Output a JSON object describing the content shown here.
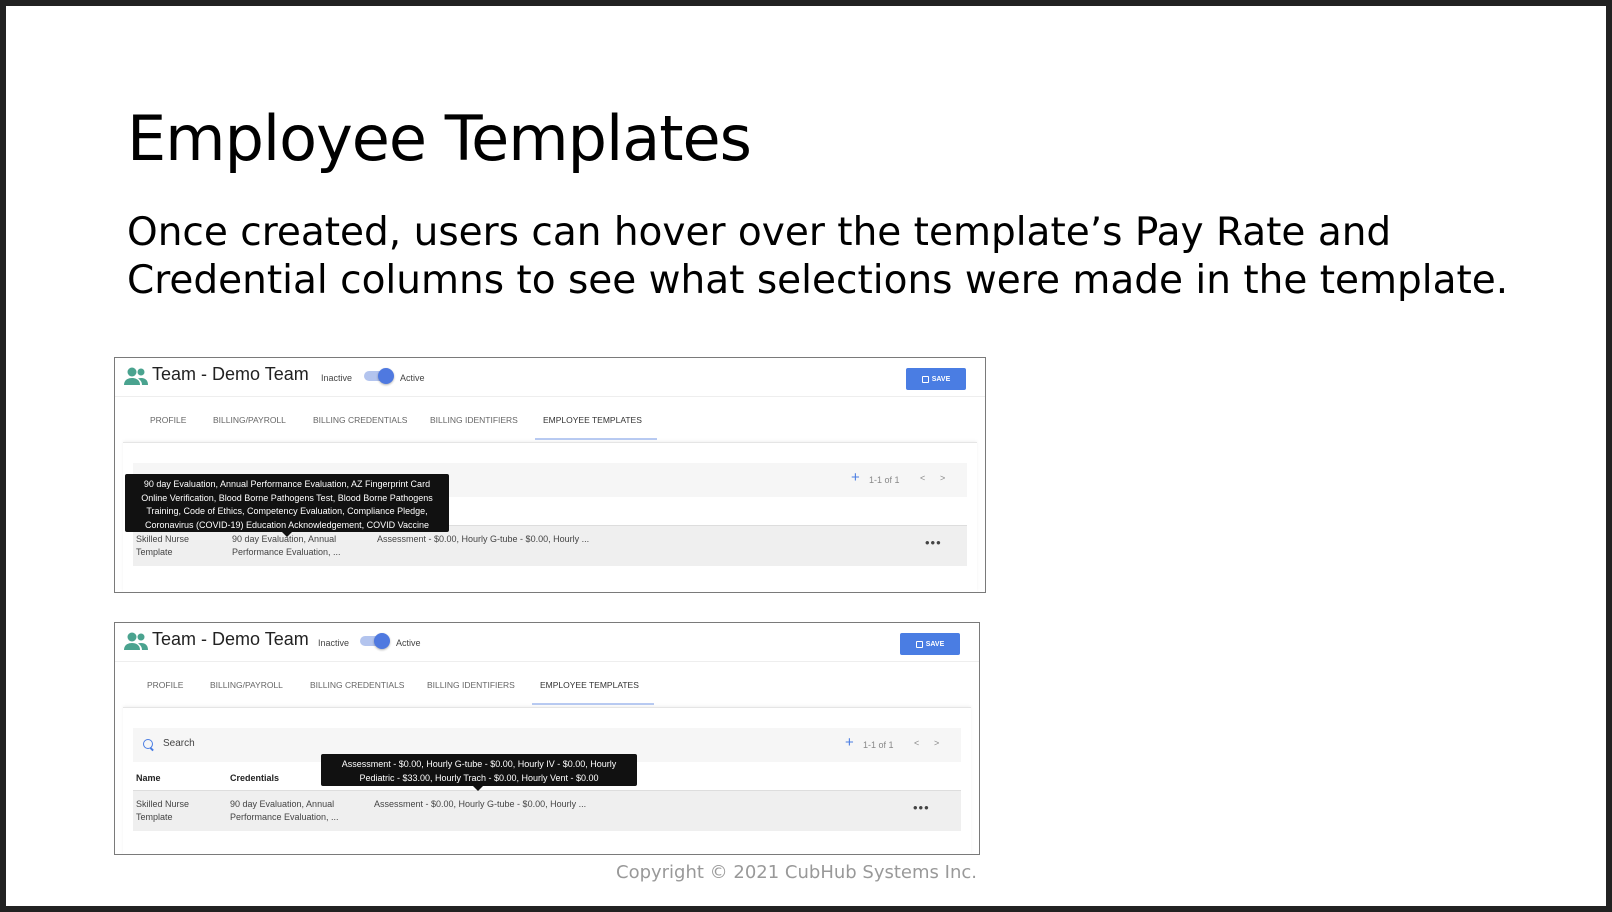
{
  "slide": {
    "title": "Employee Templates",
    "body": "Once created, users can hover over the template’s Pay Rate and Credential columns to see what selections were made in the template.",
    "copyright": "Copyright © 2021 CubHub Systems Inc."
  },
  "app": {
    "team_title": "Team - Demo Team",
    "inactive_label": "Inactive",
    "active_label": "Active",
    "save_label": "SAVE",
    "tabs": [
      "PROFILE",
      "BILLING/PAYROLL",
      "BILLING CREDENTIALS",
      "BILLING IDENTIFIERS",
      "EMPLOYEE TEMPLATES"
    ],
    "search_placeholder": "Search",
    "pager": "1-1 of 1",
    "prev": "<",
    "next": ">",
    "columns": {
      "name": "Name",
      "credentials": "Credentials"
    },
    "row": {
      "name": "Skilled Nurse\nTemplate",
      "credentials": "90 day Evaluation, Annual\nPerformance Evaluation, ...",
      "pay_rates": "Assessment - $0.00, Hourly G-tube - $0.00, Hourly ...",
      "menu": "•••"
    },
    "tooltip_credentials": "90 day Evaluation, Annual Performance Evaluation, AZ Fingerprint Card Online Verification, Blood Borne Pathogens Test, Blood Borne Pathogens Training, Code of Ethics, Competency Evaluation, Compliance Pledge, Coronavirus (COVID-19) Education Acknowledgement, COVID Vaccine",
    "tooltip_payrates": "Assessment - $0.00, Hourly G-tube - $0.00, Hourly IV - $0.00, Hourly Pediatric - $33.00, Hourly Trach - $0.00, Hourly Vent - $0.00"
  },
  "colors": {
    "accent": "#4a7de3",
    "team_icon": "#4aa38f",
    "tooltip_bg": "#111111"
  }
}
